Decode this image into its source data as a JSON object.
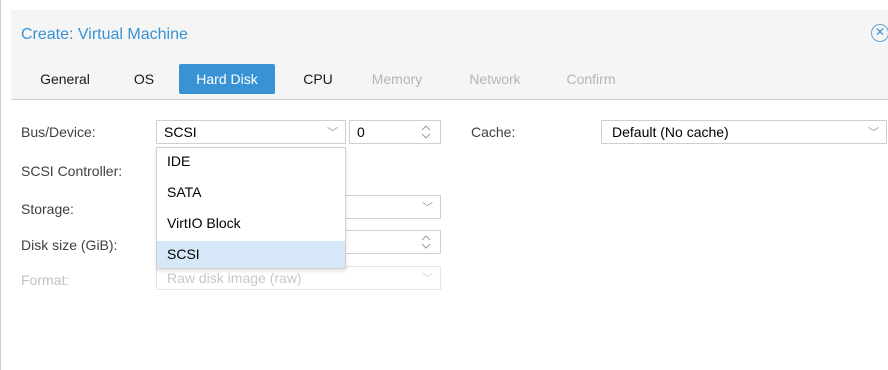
{
  "dialog": {
    "title": "Create: Virtual Machine",
    "close_icon": "close-circle-icon",
    "accent_color": "#3892d4"
  },
  "tabs": [
    {
      "label": "General",
      "state": "enabled"
    },
    {
      "label": "OS",
      "state": "enabled"
    },
    {
      "label": "Hard Disk",
      "state": "active"
    },
    {
      "label": "CPU",
      "state": "enabled"
    },
    {
      "label": "Memory",
      "state": "disabled"
    },
    {
      "label": "Network",
      "state": "disabled"
    },
    {
      "label": "Confirm",
      "state": "disabled"
    }
  ],
  "form": {
    "bus_device": {
      "label": "Bus/Device:",
      "value": "SCSI",
      "device_number": "0"
    },
    "cache": {
      "label": "Cache:",
      "value": "Default (No cache)"
    },
    "scsi_controller": {
      "label": "SCSI Controller:"
    },
    "storage": {
      "label": "Storage:"
    },
    "disk_size": {
      "label": "Disk size (GiB):"
    },
    "format": {
      "label": "Format:",
      "value": "Raw disk image (raw)",
      "disabled": true
    }
  },
  "bus_dropdown": {
    "options": [
      "IDE",
      "SATA",
      "VirtIO Block",
      "SCSI"
    ],
    "selected": "SCSI"
  }
}
